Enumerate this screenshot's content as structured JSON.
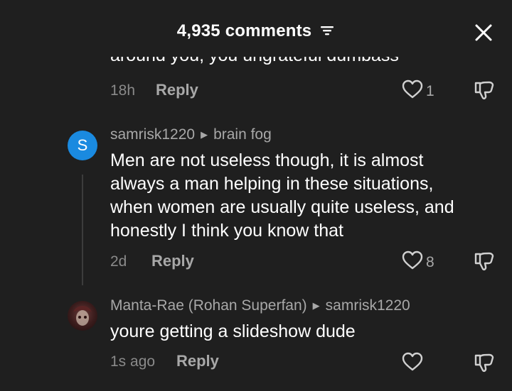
{
  "header": {
    "title": "4,935 comments",
    "sort_icon": "sort-filter-icon",
    "close_icon": "close-icon"
  },
  "comments": [
    {
      "text": "around you, you ungrateful dumbass",
      "time": "18h",
      "reply_label": "Reply",
      "likes": "1"
    },
    {
      "avatar_letter": "S",
      "avatar_color": "#1a8ae0",
      "author": "samrisk1220",
      "reply_to": "brain fog",
      "text_lines": [
        "Men are not useless though, it is almost",
        "always a man helping in these situations,",
        "when women are usually quite useless, and",
        "honestly I think you know that"
      ],
      "time": "2d",
      "reply_label": "Reply",
      "likes": "8"
    },
    {
      "author": "Manta-Rae (Rohan Superfan)",
      "reply_to": "samrisk1220",
      "text": "youre getting a slideshow dude",
      "time": "1s ago",
      "reply_label": "Reply",
      "likes": ""
    }
  ],
  "colors": {
    "background": "#1f1f1f",
    "primary_text": "#ffffff",
    "secondary_text": "#a8a8a8",
    "avatar_blue": "#1a8ae0"
  }
}
